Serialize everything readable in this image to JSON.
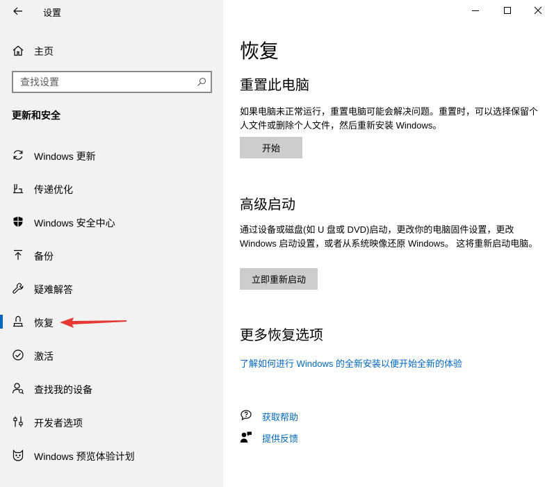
{
  "window": {
    "title": "设置",
    "back_icon": "back-arrow-icon",
    "controls": [
      "minimize-icon",
      "maximize-icon",
      "close-icon"
    ]
  },
  "sidebar": {
    "home": {
      "label": "主页",
      "icon": "home-icon"
    },
    "search": {
      "placeholder": "查找设置",
      "icon": "search-icon"
    },
    "section_title": "更新和安全",
    "items": [
      {
        "label": "Windows 更新",
        "icon": "sync-icon",
        "active": false
      },
      {
        "label": "传递优化",
        "icon": "delivery-optimization-icon",
        "active": false
      },
      {
        "label": "Windows 安全中心",
        "icon": "shield-icon",
        "active": false
      },
      {
        "label": "备份",
        "icon": "backup-arrow-icon",
        "active": false
      },
      {
        "label": "疑难解答",
        "icon": "wrench-icon",
        "active": false
      },
      {
        "label": "恢复",
        "icon": "recovery-icon",
        "active": true
      },
      {
        "label": "激活",
        "icon": "check-circle-icon",
        "active": false
      },
      {
        "label": "查找我的设备",
        "icon": "person-locate-icon",
        "active": false
      },
      {
        "label": "开发者选项",
        "icon": "developer-tools-icon",
        "active": false
      },
      {
        "label": "Windows 预览体验计划",
        "icon": "insider-cat-icon",
        "active": false
      }
    ],
    "accent_color": "#0067c0",
    "annotation_arrow_color": "#e53935"
  },
  "main": {
    "page_title": "恢复",
    "reset": {
      "heading": "重置此电脑",
      "description": "如果电脑未正常运行，重置电脑可能会解决问题。重置时，可以选择保留个人文件或删除个人文件，然后重新安装 Windows。",
      "button_label": "开始"
    },
    "advanced": {
      "heading": "高级启动",
      "description": "通过设备或磁盘(如 U 盘或 DVD)启动，更改你的电脑固件设置，更改 Windows 启动设置，或者从系统映像还原 Windows。 这将重新启动电脑。",
      "button_label": "立即重新启动"
    },
    "more": {
      "heading": "更多恢复选项",
      "link_label": "了解如何进行 Windows 的全新安装以便开始全新的体验"
    },
    "help": {
      "get_help": {
        "label": "获取帮助",
        "icon": "help-chat-icon"
      },
      "feedback": {
        "label": "提供反馈",
        "icon": "feedback-icon"
      }
    },
    "link_color": "#0067c0"
  }
}
